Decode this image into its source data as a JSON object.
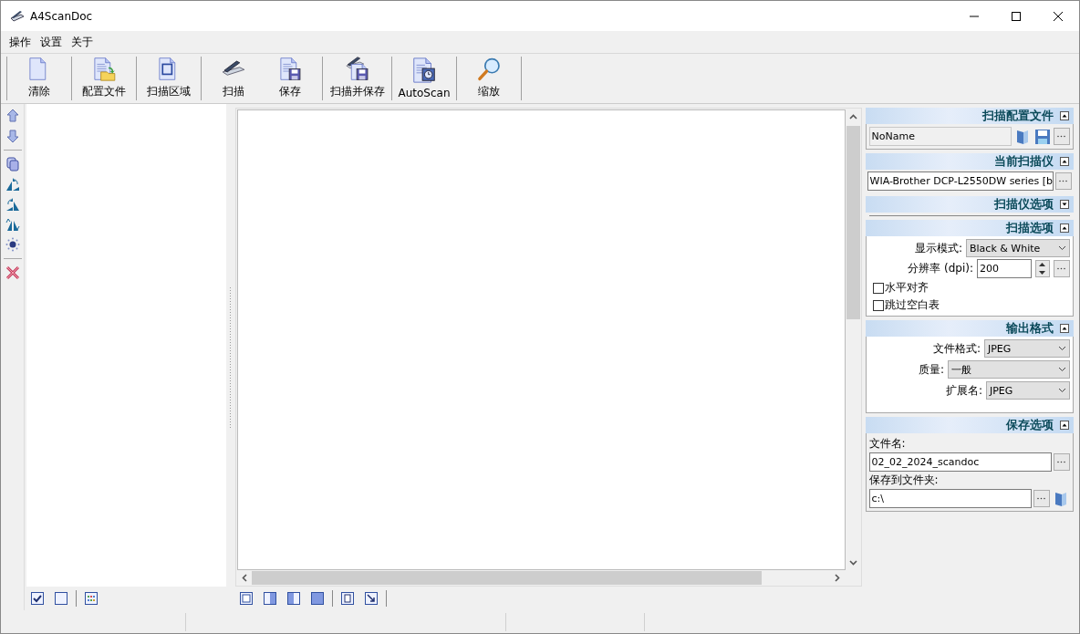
{
  "window": {
    "title": "A4ScanDoc"
  },
  "menu": [
    "操作",
    "设置",
    "关于"
  ],
  "toolbar": [
    {
      "buttons": [
        {
          "label": "清除"
        }
      ]
    },
    {
      "buttons": [
        {
          "label": "配置文件"
        }
      ]
    },
    {
      "buttons": [
        {
          "label": "扫描区域"
        }
      ]
    },
    {
      "buttons": [
        {
          "label": "扫描"
        },
        {
          "label": "保存"
        }
      ]
    },
    {
      "buttons": [
        {
          "label": "扫描并保存"
        }
      ]
    },
    {
      "buttons": [
        {
          "label": "AutoScan"
        }
      ]
    },
    {
      "buttons": [
        {
          "label": "缩放"
        }
      ]
    }
  ],
  "panel": {
    "sections": [
      {
        "kind": "profile",
        "title": "扫描配置文件",
        "expanded": true,
        "value": "NoName"
      },
      {
        "kind": "scanner",
        "title": "当前扫描仪",
        "expanded": true,
        "value": "WIA-Brother DCP-L2550DW series [b"
      },
      {
        "kind": "empty",
        "title": "扫描仪选项",
        "expanded": false
      },
      {
        "kind": "scan",
        "title": "扫描选项",
        "expanded": true,
        "mode_label": "显示模式:",
        "mode": "Black & White",
        "dpi_label": "分辨率 (dpi):",
        "dpi": "200",
        "checkboxes": [
          {
            "label": "水平对齐",
            "checked": false
          },
          {
            "label": "跳过空白表",
            "checked": false
          }
        ]
      },
      {
        "kind": "output",
        "title": "输出格式",
        "expanded": true,
        "fields": [
          {
            "label": "文件格式:",
            "value": "JPEG"
          },
          {
            "label": "质量:",
            "value": "一般"
          },
          {
            "label": "扩展名:",
            "value": "JPEG"
          }
        ]
      },
      {
        "kind": "save",
        "title": "保存选项",
        "expanded": true,
        "file_label": "文件名:",
        "file": "02_02_2024_scandoc",
        "folder_label": "保存到文件夹:",
        "folder": "c:\\"
      }
    ]
  }
}
